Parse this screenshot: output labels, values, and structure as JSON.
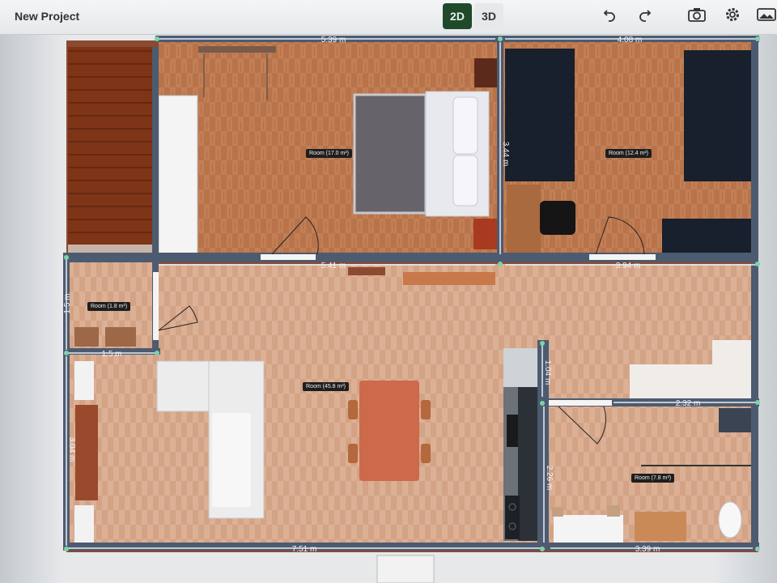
{
  "app": {
    "title": "New Project",
    "view_2d": "2D",
    "view_3d": "3D"
  },
  "toolbar": {
    "undo_icon": "undo-icon",
    "redo_icon": "redo-icon",
    "camera_icon": "camera-icon",
    "settings_icon": "gear-icon",
    "gallery_icon": "image-icon"
  },
  "colors": {
    "accent": "#1f4a2a",
    "wall": "#4d5b70",
    "floor_wood": "#b8734a",
    "floor_light": "#d6a88a"
  },
  "rooms": [
    {
      "label": "Room (17.0 m²)"
    },
    {
      "label": "Room (12.4 m²)"
    },
    {
      "label": "Room (1.8 m²)"
    },
    {
      "label": "Room (45.8 m²)"
    },
    {
      "label": "Room (7.8 m²)"
    }
  ],
  "dimensions": {
    "top_left": "5.39 m",
    "top_right": "4.08 m",
    "mid_left": "5.41 m",
    "mid_right": "3.94 m",
    "vertical_mid": "3.44 m",
    "small_width": "1.5 m",
    "small_height": "1.5 m",
    "left_height": "3.04 m",
    "kitchen_height": "1.04 m",
    "bath_height": "2.26 m",
    "bath_width": "2.32 m",
    "bottom_left": "7.51 m",
    "bottom_right": "3.39 m"
  }
}
